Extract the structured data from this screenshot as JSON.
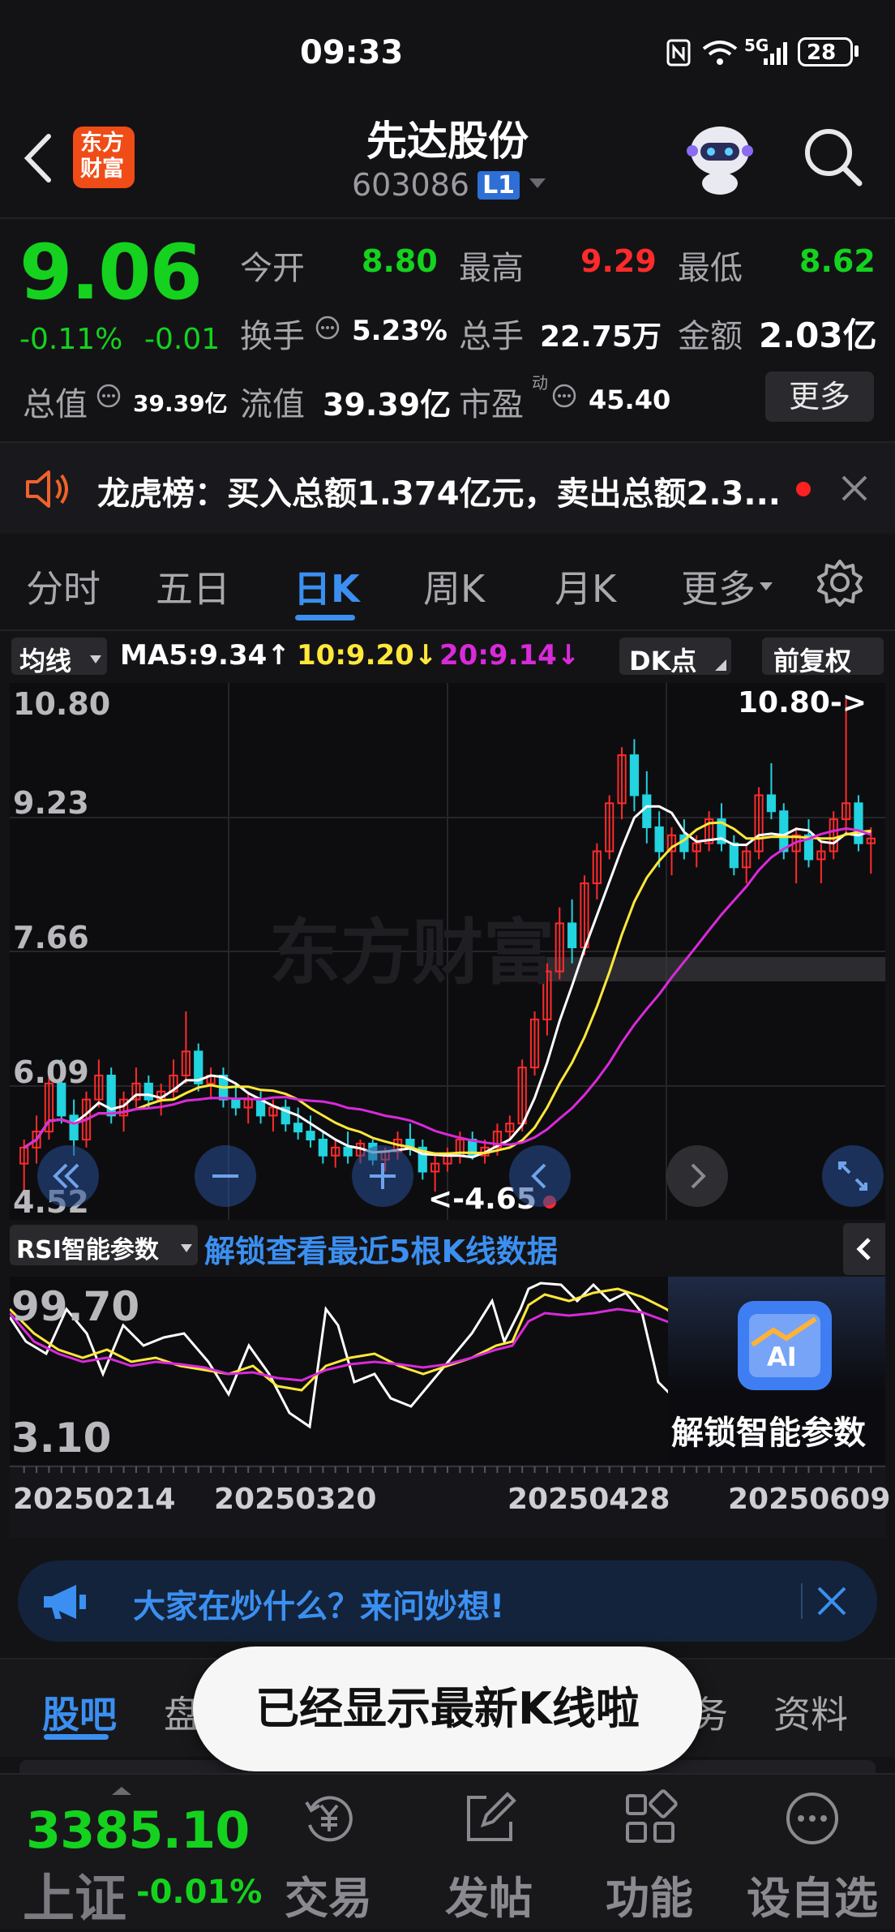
{
  "status_bar": {
    "time": "09:33",
    "battery": "28",
    "network": "5G"
  },
  "header": {
    "title": "先达股份",
    "code": "603086",
    "level_badge": "L1",
    "logo_line1": "东方",
    "logo_line2": "财富"
  },
  "quote": {
    "price": "9.06",
    "change_pct": "-0.11%",
    "change": "-0.01",
    "open_label": "今开",
    "open": "8.80",
    "high_label": "最高",
    "high": "9.29",
    "low_label": "最低",
    "low": "8.62",
    "turnover_label": "换手",
    "turnover": "5.23%",
    "volume_label": "总手",
    "volume": "22.75万",
    "amount_label": "金额",
    "amount": "2.03亿",
    "total_value_label": "总值",
    "total_value": "39.39亿",
    "float_value_label": "流值",
    "float_value": "39.39亿",
    "pe_label": "市盈",
    "pe_sup": "动",
    "pe": "45.40",
    "more_label": "更多"
  },
  "notice": {
    "text": "龙虎榜：买入总额1.374亿元，卖出总额2.3..."
  },
  "chart_tabs": [
    "分时",
    "五日",
    "日K",
    "周K",
    "月K",
    "更多"
  ],
  "active_tab": 2,
  "indicator_bar": {
    "ma_select": "均线",
    "ma5": "MA5:9.34↑",
    "ma10": "10:9.20↓",
    "ma20": "20:9.14↓",
    "dk": "DK点",
    "adjust": "前复权"
  },
  "colors": {
    "up": "#ff2b2b",
    "down": "#22d3e0",
    "ma5": "#ffffff",
    "ma10": "#ffe83a",
    "ma20": "#d92ad9",
    "accent": "#3b8ff0"
  },
  "kline": {
    "y_labels": [
      "10.80",
      "9.23",
      "7.66",
      "6.09",
      "4.52"
    ],
    "max_marker": "10.80->",
    "min_marker": "<-4.65",
    "watermark": "东方财富"
  },
  "rsi": {
    "select": "RSI智能参数",
    "unlock_link": "解锁查看最近5根K线数据",
    "y_top": "99.70",
    "y_bottom": "3.10",
    "ai_label": "AI",
    "ai_unlock": "解锁智能参数"
  },
  "x_dates": [
    "20250214",
    "20250320",
    "20250428",
    "20250609"
  ],
  "ask_banner": {
    "text": "大家在炒什么？来问妙想!"
  },
  "bottom_tabs": [
    "股吧",
    "盘",
    "务",
    "资料"
  ],
  "toast": "已经显示最新K线啦",
  "index_ticker": {
    "value": "3385.10",
    "name": "上证",
    "change": "-0.01%"
  },
  "bottom_nav": [
    "交易",
    "发帖",
    "功能",
    "设自选"
  ],
  "chart_data": {
    "type": "candlestick",
    "ylim": [
      4.52,
      10.8
    ],
    "x_ticks": [
      "20250214",
      "20250320",
      "20250428",
      "20250609"
    ],
    "candles": [
      [
        5.0,
        5.3,
        4.6,
        5.2
      ],
      [
        5.2,
        5.6,
        5.0,
        5.4
      ],
      [
        5.4,
        6.2,
        5.3,
        6.0
      ],
      [
        6.0,
        6.3,
        5.5,
        5.6
      ],
      [
        5.6,
        5.8,
        5.1,
        5.3
      ],
      [
        5.3,
        5.9,
        5.2,
        5.8
      ],
      [
        5.8,
        6.3,
        5.7,
        6.1
      ],
      [
        6.1,
        6.2,
        5.5,
        5.6
      ],
      [
        5.6,
        5.9,
        5.4,
        5.8
      ],
      [
        5.8,
        6.2,
        5.7,
        6.0
      ],
      [
        6.0,
        6.1,
        5.7,
        5.8
      ],
      [
        5.8,
        6.0,
        5.6,
        5.9
      ],
      [
        5.9,
        6.3,
        5.8,
        6.1
      ],
      [
        6.1,
        6.9,
        6.0,
        6.4
      ],
      [
        6.4,
        6.5,
        5.9,
        6.0
      ],
      [
        6.0,
        6.2,
        5.8,
        6.1
      ],
      [
        6.1,
        6.2,
        5.7,
        5.8
      ],
      [
        5.8,
        6.0,
        5.6,
        5.7
      ],
      [
        5.7,
        5.9,
        5.5,
        5.8
      ],
      [
        5.8,
        5.9,
        5.5,
        5.6
      ],
      [
        5.6,
        5.8,
        5.4,
        5.7
      ],
      [
        5.7,
        5.8,
        5.4,
        5.5
      ],
      [
        5.5,
        5.7,
        5.3,
        5.4
      ],
      [
        5.4,
        5.6,
        5.2,
        5.3
      ],
      [
        5.3,
        5.4,
        5.0,
        5.1
      ],
      [
        5.1,
        5.3,
        4.95,
        5.2
      ],
      [
        5.2,
        5.4,
        5.0,
        5.1
      ],
      [
        5.1,
        5.3,
        5.0,
        5.25
      ],
      [
        5.25,
        5.3,
        4.98,
        5.05
      ],
      [
        5.05,
        5.2,
        4.9,
        5.15
      ],
      [
        5.15,
        5.4,
        5.05,
        5.3
      ],
      [
        5.3,
        5.5,
        5.1,
        5.2
      ],
      [
        5.2,
        5.3,
        4.8,
        4.9
      ],
      [
        4.9,
        5.1,
        4.65,
        5.0
      ],
      [
        5.0,
        5.2,
        4.9,
        5.1
      ],
      [
        5.1,
        5.4,
        5.0,
        5.3
      ],
      [
        5.3,
        5.4,
        5.05,
        5.1
      ],
      [
        5.1,
        5.3,
        5.0,
        5.2
      ],
      [
        5.2,
        5.5,
        5.1,
        5.4
      ],
      [
        5.4,
        5.6,
        5.3,
        5.5
      ],
      [
        5.5,
        6.3,
        5.4,
        6.2
      ],
      [
        6.2,
        6.9,
        6.1,
        6.8
      ],
      [
        6.8,
        7.5,
        6.6,
        7.4
      ],
      [
        7.4,
        8.2,
        7.3,
        8.0
      ],
      [
        8.0,
        8.3,
        7.5,
        7.7
      ],
      [
        7.7,
        8.6,
        7.6,
        8.5
      ],
      [
        8.5,
        9.0,
        8.3,
        8.9
      ],
      [
        8.9,
        9.6,
        8.8,
        9.5
      ],
      [
        9.5,
        10.2,
        9.3,
        10.1
      ],
      [
        10.1,
        10.3,
        9.4,
        9.6
      ],
      [
        9.6,
        9.9,
        9.0,
        9.2
      ],
      [
        9.2,
        9.4,
        8.7,
        8.9
      ],
      [
        8.9,
        9.2,
        8.6,
        9.1
      ],
      [
        9.1,
        9.3,
        8.8,
        8.9
      ],
      [
        8.9,
        9.1,
        8.7,
        9.0
      ],
      [
        9.0,
        9.4,
        8.9,
        9.3
      ],
      [
        9.3,
        9.5,
        8.9,
        9.0
      ],
      [
        9.0,
        9.1,
        8.6,
        8.7
      ],
      [
        8.7,
        9.0,
        8.5,
        8.9
      ],
      [
        8.9,
        9.7,
        8.8,
        9.6
      ],
      [
        9.6,
        10.0,
        9.3,
        9.4
      ],
      [
        9.4,
        9.5,
        8.8,
        8.9
      ],
      [
        8.9,
        9.2,
        8.5,
        9.1
      ],
      [
        9.1,
        9.3,
        8.7,
        8.8
      ],
      [
        8.8,
        9.0,
        8.5,
        8.9
      ],
      [
        8.9,
        9.4,
        8.8,
        9.3
      ],
      [
        9.3,
        10.8,
        9.1,
        9.5
      ],
      [
        9.5,
        9.6,
        8.9,
        9.0
      ],
      [
        9.0,
        9.2,
        8.62,
        9.06
      ]
    ]
  }
}
